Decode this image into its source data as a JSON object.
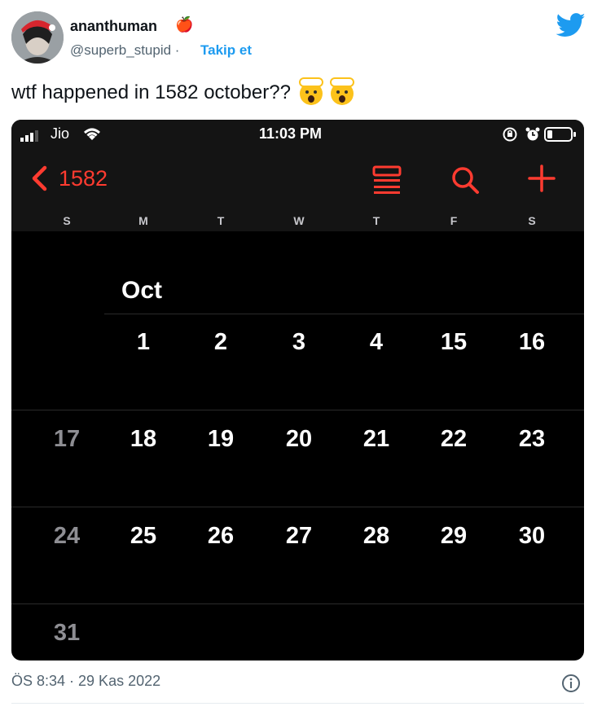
{
  "tweet": {
    "username": "ananthuman",
    "emoji": "🍎",
    "handle": "@superb_stupid",
    "separator": " · ",
    "follow_label": "Takip et",
    "text": "wtf happened in 1582 october??",
    "timestamp": "ÖS 8:34 · 29 Kas 2022",
    "brand_color": "#1d9bf0"
  },
  "phone": {
    "carrier": "Jio",
    "time": "11:03 PM",
    "back_label": "1582",
    "accent_color": "#ff3b30",
    "weekdays": [
      "S",
      "M",
      "T",
      "W",
      "T",
      "F",
      "S"
    ],
    "month": "Oct",
    "weeks": [
      [
        "",
        "1",
        "2",
        "3",
        "4",
        "15",
        "16"
      ],
      [
        "17",
        "18",
        "19",
        "20",
        "21",
        "22",
        "23"
      ],
      [
        "24",
        "25",
        "26",
        "27",
        "28",
        "29",
        "30"
      ],
      [
        "31",
        "",
        "",
        "",
        "",
        "",
        ""
      ]
    ],
    "icons": [
      "signal-icon",
      "wifi-icon",
      "rotation-lock-icon",
      "alarm-icon",
      "battery-icon",
      "chevron-left-icon",
      "list-view-icon",
      "search-icon",
      "add-icon"
    ]
  }
}
